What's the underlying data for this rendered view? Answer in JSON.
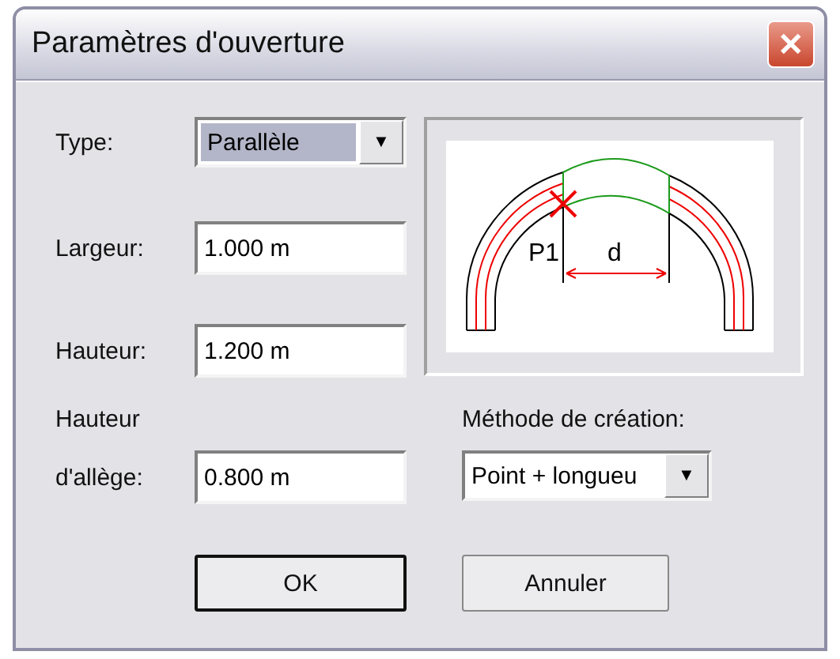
{
  "window": {
    "title": "Paramètres d'ouverture",
    "close": "✕"
  },
  "fields": [
    {
      "kind": "combo",
      "label": "Type:",
      "value": "Parallèle",
      "arrow": "▼"
    },
    {
      "kind": "text",
      "label": "Largeur:",
      "value": "1.000 m"
    },
    {
      "kind": "text",
      "label": "Hauteur:",
      "value": "1.200 m"
    },
    {
      "kind": "text",
      "label_lines": [
        "Hauteur",
        "d'allège:"
      ],
      "value": "0.800 m"
    }
  ],
  "preview": {
    "point_label": "P1",
    "distance_label": "d"
  },
  "method": {
    "label": "Méthode de création:",
    "value": "Point + longueu",
    "arrow": "▼"
  },
  "buttons": [
    {
      "label": "OK",
      "default": true
    },
    {
      "label": "Annuler",
      "default": false
    }
  ]
}
